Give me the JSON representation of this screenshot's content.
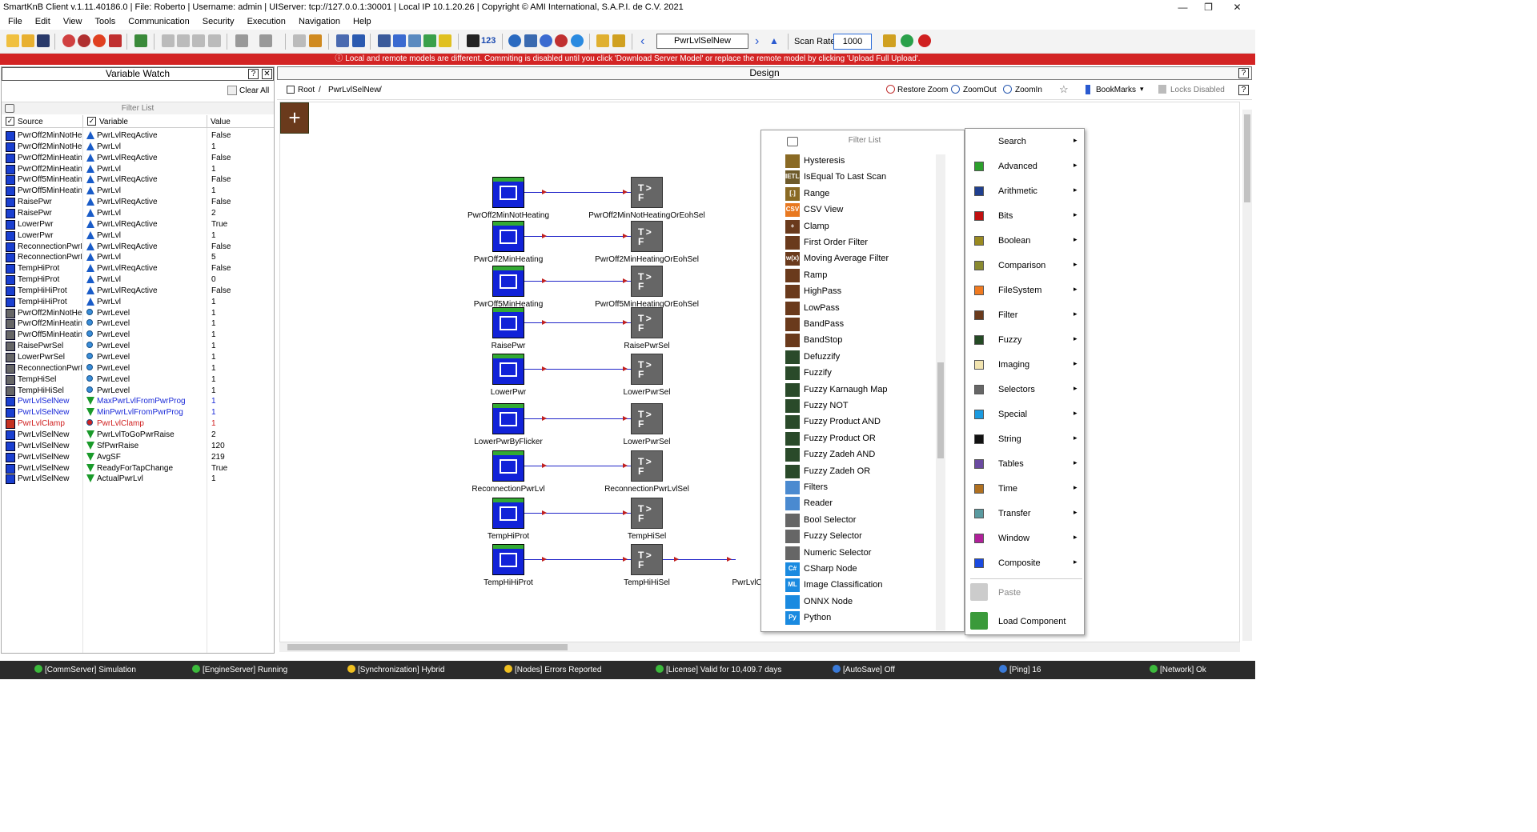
{
  "window": {
    "title": "SmartKnB Client v.1.11.40186.0  |  File: Roberto  |  Username: admin  |  UIServer: tcp://127.0.0.1:30001  |  Local IP 10.1.20.26  |  Copyright ©  AMI International, S.A.P.I. de C.V. 2021",
    "min": "—",
    "max": "❐",
    "close": "✕"
  },
  "menu": [
    "File",
    "Edit",
    "View",
    "Tools",
    "Communication",
    "Security",
    "Execution",
    "Navigation",
    "Help"
  ],
  "toolbar": {
    "node_path": "PwrLvlSelNew",
    "scan_rate_label": "Scan Rate:",
    "scan_rate_value": "1000",
    "counter_label": "123"
  },
  "banner": "ⓘ Local and remote models are different. Commiting is disabled until you click 'Download Server Model' or replace the remote model by clicking 'Upload Full Upload'.",
  "variable_watch": {
    "title": "Variable Watch",
    "help": "?",
    "close": "✕",
    "clear_all": "Clear All",
    "filter_placeholder": "Filter List",
    "col_source": "Source",
    "col_variable": "Variable",
    "col_value": "Value",
    "rows": [
      {
        "source": "PwrOff2MinNotHe...",
        "variable": "PwrLvlReqActive",
        "value": "False",
        "s": "b",
        "v": "up",
        "c": ""
      },
      {
        "source": "PwrOff2MinNotHe...",
        "variable": "PwrLvl",
        "value": "1",
        "s": "b",
        "v": "up",
        "c": ""
      },
      {
        "source": "PwrOff2MinHeating",
        "variable": "PwrLvlReqActive",
        "value": "False",
        "s": "b",
        "v": "up",
        "c": ""
      },
      {
        "source": "PwrOff2MinHeating",
        "variable": "PwrLvl",
        "value": "1",
        "s": "b",
        "v": "up",
        "c": ""
      },
      {
        "source": "PwrOff5MinHeating",
        "variable": "PwrLvlReqActive",
        "value": "False",
        "s": "b",
        "v": "up",
        "c": ""
      },
      {
        "source": "PwrOff5MinHeating",
        "variable": "PwrLvl",
        "value": "1",
        "s": "b",
        "v": "up",
        "c": ""
      },
      {
        "source": "RaisePwr",
        "variable": "PwrLvlReqActive",
        "value": "False",
        "s": "b",
        "v": "up",
        "c": ""
      },
      {
        "source": "RaisePwr",
        "variable": "PwrLvl",
        "value": "2",
        "s": "b",
        "v": "up",
        "c": ""
      },
      {
        "source": "LowerPwr",
        "variable": "PwrLvlReqActive",
        "value": "True",
        "s": "b",
        "v": "up",
        "c": ""
      },
      {
        "source": "LowerPwr",
        "variable": "PwrLvl",
        "value": "1",
        "s": "b",
        "v": "up",
        "c": ""
      },
      {
        "source": "ReconnectionPwrLvl",
        "variable": "PwrLvlReqActive",
        "value": "False",
        "s": "b",
        "v": "up",
        "c": ""
      },
      {
        "source": "ReconnectionPwrLvl",
        "variable": "PwrLvl",
        "value": "5",
        "s": "b",
        "v": "up",
        "c": ""
      },
      {
        "source": "TempHiProt",
        "variable": "PwrLvlReqActive",
        "value": "False",
        "s": "b",
        "v": "up",
        "c": ""
      },
      {
        "source": "TempHiProt",
        "variable": "PwrLvl",
        "value": "0",
        "s": "b",
        "v": "up",
        "c": ""
      },
      {
        "source": "TempHiHiProt",
        "variable": "PwrLvlReqActive",
        "value": "False",
        "s": "b",
        "v": "up",
        "c": ""
      },
      {
        "source": "TempHiHiProt",
        "variable": "PwrLvl",
        "value": "1",
        "s": "b",
        "v": "up",
        "c": ""
      },
      {
        "source": "PwrOff2MinNotHe...",
        "variable": "PwrLevel",
        "value": "1",
        "s": "g",
        "v": "dot",
        "c": ""
      },
      {
        "source": "PwrOff2MinHeatin...",
        "variable": "PwrLevel",
        "value": "1",
        "s": "g",
        "v": "dot",
        "c": ""
      },
      {
        "source": "PwrOff5MinHeatin...",
        "variable": "PwrLevel",
        "value": "1",
        "s": "g",
        "v": "dot",
        "c": ""
      },
      {
        "source": "RaisePwrSel",
        "variable": "PwrLevel",
        "value": "1",
        "s": "g",
        "v": "dot",
        "c": ""
      },
      {
        "source": "LowerPwrSel",
        "variable": "PwrLevel",
        "value": "1",
        "s": "g",
        "v": "dot",
        "c": ""
      },
      {
        "source": "ReconnectionPwrL...",
        "variable": "PwrLevel",
        "value": "1",
        "s": "g",
        "v": "dot",
        "c": ""
      },
      {
        "source": "TempHiSel",
        "variable": "PwrLevel",
        "value": "1",
        "s": "g",
        "v": "dot",
        "c": ""
      },
      {
        "source": "TempHiHiSel",
        "variable": "PwrLevel",
        "value": "1",
        "s": "g",
        "v": "dot",
        "c": ""
      },
      {
        "source": "PwrLvlSelNew",
        "variable": "MaxPwrLvlFromPwrProg",
        "value": "1",
        "s": "b",
        "v": "dn",
        "c": "#1a2ad8"
      },
      {
        "source": "PwrLvlSelNew",
        "variable": "MinPwrLvlFromPwrProg",
        "value": "1",
        "s": "b",
        "v": "dn",
        "c": "#1a2ad8"
      },
      {
        "source": "PwrLvlClamp",
        "variable": "PwrLvlClamp",
        "value": "1",
        "s": "r",
        "v": "dot",
        "c": "#d02020"
      },
      {
        "source": "PwrLvlSelNew",
        "variable": "PwrLvlToGoPwrRaise",
        "value": "2",
        "s": "b",
        "v": "dn",
        "c": ""
      },
      {
        "source": "PwrLvlSelNew",
        "variable": "SfPwrRaise",
        "value": "120",
        "s": "b",
        "v": "dn",
        "c": ""
      },
      {
        "source": "PwrLvlSelNew",
        "variable": "AvgSF",
        "value": "219",
        "s": "b",
        "v": "dn",
        "c": ""
      },
      {
        "source": "PwrLvlSelNew",
        "variable": "ReadyForTapChange",
        "value": "True",
        "s": "b",
        "v": "dn",
        "c": ""
      },
      {
        "source": "PwrLvlSelNew",
        "variable": "ActualPwrLvl",
        "value": "1",
        "s": "b",
        "v": "dn",
        "c": ""
      }
    ]
  },
  "design": {
    "title": "Design",
    "help": "?",
    "bc_root": "Root",
    "bc_sep": "/",
    "bc_node": "PwrLvlSelNew",
    "bc_sep2": "/",
    "restore_zoom": "Restore Zoom",
    "zoom_out": "ZoomOut",
    "zoom_in": "ZoomIn",
    "bookmarks": "BookMarks",
    "locks": "Locks Disabled",
    "nodes_left": [
      "PwrOff2MinNotHeating",
      "PwrOff2MinHeating",
      "PwrOff5MinHeating",
      "RaisePwr",
      "LowerPwr",
      "LowerPwrByFlicker",
      "ReconnectionPwrLvl",
      "TempHiProt",
      "TempHiHiProt"
    ],
    "nodes_right": [
      "PwrOff2MinNotHeatingOrEohSel",
      "PwrOff2MinHeatingOrEohSel",
      "PwrOff5MinHeatingOrEohSel",
      "RaisePwrSel",
      "LowerPwrSel",
      "LowerPwrSel",
      "ReconnectionPwrLvlSel",
      "TempHiSel",
      "TempHiHiSel"
    ],
    "clamp_node": "PwrLvlCla"
  },
  "filter_list": {
    "placeholder": "Filter List",
    "items": [
      {
        "label": "Hysteresis",
        "icon": "",
        "color": "#8a6a24"
      },
      {
        "label": "IsEqual To Last Scan",
        "icon": "IETLS",
        "color": "#6e5a2a"
      },
      {
        "label": "Range",
        "icon": "[.]",
        "color": "#8a6a24"
      },
      {
        "label": "CSV View",
        "icon": "CSV",
        "color": "#e87820"
      },
      {
        "label": "Clamp",
        "icon": "+",
        "color": "#6a3a1c"
      },
      {
        "label": "First Order Filter",
        "icon": "",
        "color": "#6a3a1c"
      },
      {
        "label": "Moving Average Filter",
        "icon": "w(x)",
        "color": "#6a3a1c"
      },
      {
        "label": "Ramp",
        "icon": "",
        "color": "#6a3a1c"
      },
      {
        "label": "HighPass",
        "icon": "",
        "color": "#6a3a1c"
      },
      {
        "label": "LowPass",
        "icon": "",
        "color": "#6a3a1c"
      },
      {
        "label": "BandPass",
        "icon": "",
        "color": "#6a3a1c"
      },
      {
        "label": "BandStop",
        "icon": "",
        "color": "#6a3a1c"
      },
      {
        "label": "Defuzzify",
        "icon": "",
        "color": "#2a4a2a"
      },
      {
        "label": "Fuzzify",
        "icon": "",
        "color": "#2a4a2a"
      },
      {
        "label": "Fuzzy Karnaugh Map",
        "icon": "",
        "color": "#2a4a2a"
      },
      {
        "label": "Fuzzy NOT",
        "icon": "",
        "color": "#2a4a2a"
      },
      {
        "label": "Fuzzy Product AND",
        "icon": "",
        "color": "#2a4a2a"
      },
      {
        "label": "Fuzzy Product OR",
        "icon": "",
        "color": "#2a4a2a"
      },
      {
        "label": "Fuzzy Zadeh AND",
        "icon": "",
        "color": "#2a4a2a"
      },
      {
        "label": "Fuzzy Zadeh OR",
        "icon": "",
        "color": "#2a4a2a"
      },
      {
        "label": "Filters",
        "icon": "",
        "color": "#4a8ad0"
      },
      {
        "label": "Reader",
        "icon": "",
        "color": "#4a8ad0"
      },
      {
        "label": "Bool Selector",
        "icon": "",
        "color": "#666"
      },
      {
        "label": "Fuzzy Selector",
        "icon": "",
        "color": "#666"
      },
      {
        "label": "Numeric Selector",
        "icon": "",
        "color": "#666"
      },
      {
        "label": "CSharp Node",
        "icon": "C#",
        "color": "#1a8ae0"
      },
      {
        "label": "Image Classification",
        "icon": "ML",
        "color": "#1a8ae0"
      },
      {
        "label": "ONNX Node",
        "icon": "",
        "color": "#1a8ae0"
      },
      {
        "label": "Python",
        "icon": "Py",
        "color": "#1a8ae0"
      }
    ]
  },
  "categories": [
    {
      "label": "Search",
      "color": "",
      "arrow": "▸"
    },
    {
      "label": "Advanced",
      "color": "#2ca02c",
      "arrow": "▸"
    },
    {
      "label": "Arithmetic",
      "color": "#1f3f8f",
      "arrow": "▸"
    },
    {
      "label": "Bits",
      "color": "#c01010",
      "arrow": "▸"
    },
    {
      "label": "Boolean",
      "color": "#9a8a20",
      "arrow": "▸"
    },
    {
      "label": "Comparison",
      "color": "#8a8a30",
      "arrow": "▸"
    },
    {
      "label": "FileSystem",
      "color": "#f07a20",
      "arrow": "▸"
    },
    {
      "label": "Filter",
      "color": "#6a3a1c",
      "arrow": "▸"
    },
    {
      "label": "Fuzzy",
      "color": "#244a24",
      "arrow": "▸"
    },
    {
      "label": "Imaging",
      "color": "#f2e4b0",
      "arrow": "▸"
    },
    {
      "label": "Selectors",
      "color": "#666666",
      "arrow": "▸"
    },
    {
      "label": "Special",
      "color": "#1a9ae0",
      "arrow": "▸"
    },
    {
      "label": "String",
      "color": "#111111",
      "arrow": "▸"
    },
    {
      "label": "Tables",
      "color": "#6a4aa0",
      "arrow": "▸"
    },
    {
      "label": "Time",
      "color": "#b07020",
      "arrow": "▸"
    },
    {
      "label": "Transfer",
      "color": "#5a9aa0",
      "arrow": "▸"
    },
    {
      "label": "Window",
      "color": "#b0209a",
      "arrow": "▸"
    },
    {
      "label": "Composite",
      "color": "#1a4ae0",
      "arrow": "▸"
    }
  ],
  "context": {
    "paste": "Paste",
    "load_component": "Load Component"
  },
  "status": [
    {
      "text": "[CommServer] Simulation",
      "color": "#3cba3c"
    },
    {
      "text": "[EngineServer] Running",
      "color": "#3cba3c"
    },
    {
      "text": "[Synchronization] Hybrid",
      "color": "#f0c020"
    },
    {
      "text": "[Nodes] Errors Reported",
      "color": "#f0c020"
    },
    {
      "text": "[License] Valid for 10,409.7 days",
      "color": "#3cba3c"
    },
    {
      "text": "[AutoSave] Off",
      "color": "#3a7ad8"
    },
    {
      "text": "[Ping] 16",
      "color": "#3a7ad8"
    },
    {
      "text": "[Network] Ok",
      "color": "#3cba3c"
    }
  ]
}
